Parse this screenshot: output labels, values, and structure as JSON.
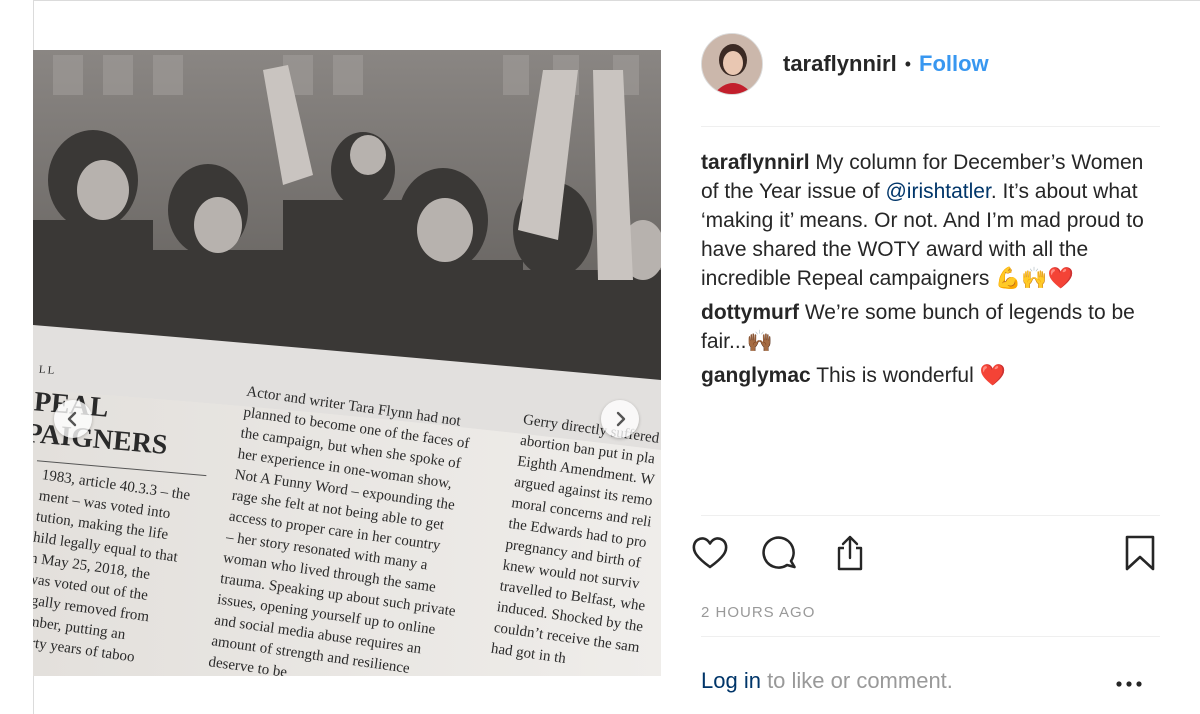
{
  "post": {
    "username": "taraflynnirl",
    "separator": "•",
    "follow_label": "Follow"
  },
  "comments": [
    {
      "username": "taraflynnirl",
      "text_before": "My column for December’s Women of the Year issue of ",
      "mention": "@irishtatler",
      "text_after": ". It’s about what ‘making it’ means. Or not. And I’m mad proud to have shared the WOTY award with all the incredible Repeal campaigners ",
      "emoji": "💪🙌❤️"
    },
    {
      "username": "dottymurf",
      "text": "We’re some bunch of legends to be fair...",
      "emoji": "🙌🏾"
    },
    {
      "username": "ganglymac",
      "text": "This is wonderful ",
      "emoji": "❤️"
    }
  ],
  "actions": {
    "icons": [
      "heart-icon",
      "comment-icon",
      "share-icon",
      "bookmark-icon"
    ]
  },
  "timestamp": "2 HOURS AGO",
  "login": {
    "link": "Log in",
    "text": " to like or comment.",
    "more_icon": "more-icon"
  },
  "media": {
    "nav_prev_icon": "chevron-left-icon",
    "nav_next_icon": "chevron-right-icon",
    "slide_count": 2,
    "active_slide": 2,
    "magazine": {
      "left_heading_1": "PEAL",
      "left_heading_2": "PAIGNERS",
      "left_kicker": "LL",
      "col1": [
        "1983, article 40.3.3 – the",
        "ment – was voted into",
        "tution, making the life",
        "hild legally equal to that",
        "n May 25, 2018, the",
        "was voted out of the",
        "egally removed from",
        "ember, putting an",
        "hirty years of taboo"
      ],
      "col2": [
        "Actor and writer Tara Flynn had not",
        "planned to become one of the faces of",
        "the campaign, but when she spoke of",
        "her experience in one-woman show,",
        "Not A Funny Word – expounding the",
        "rage she felt at not being able to get",
        "access to proper care in her country",
        "– her story resonated with many a",
        "woman who lived through the same",
        "trauma. Speaking up about such private",
        "issues, opening yourself up to online",
        "and social media abuse requires an",
        "amount of strength and resilience",
        "deserve to be"
      ],
      "col3": [
        "Gerry directly suffered",
        "abortion ban put in pla",
        "Eighth Amendment. W",
        "argued against its remo",
        "moral concerns and reli",
        "the Edwards had to pro",
        "pregnancy and birth of",
        "knew would not surviv",
        "travelled to Belfast, whe",
        "induced. Shocked by the",
        "couldn’t receive the sam",
        "had got in th"
      ]
    }
  }
}
